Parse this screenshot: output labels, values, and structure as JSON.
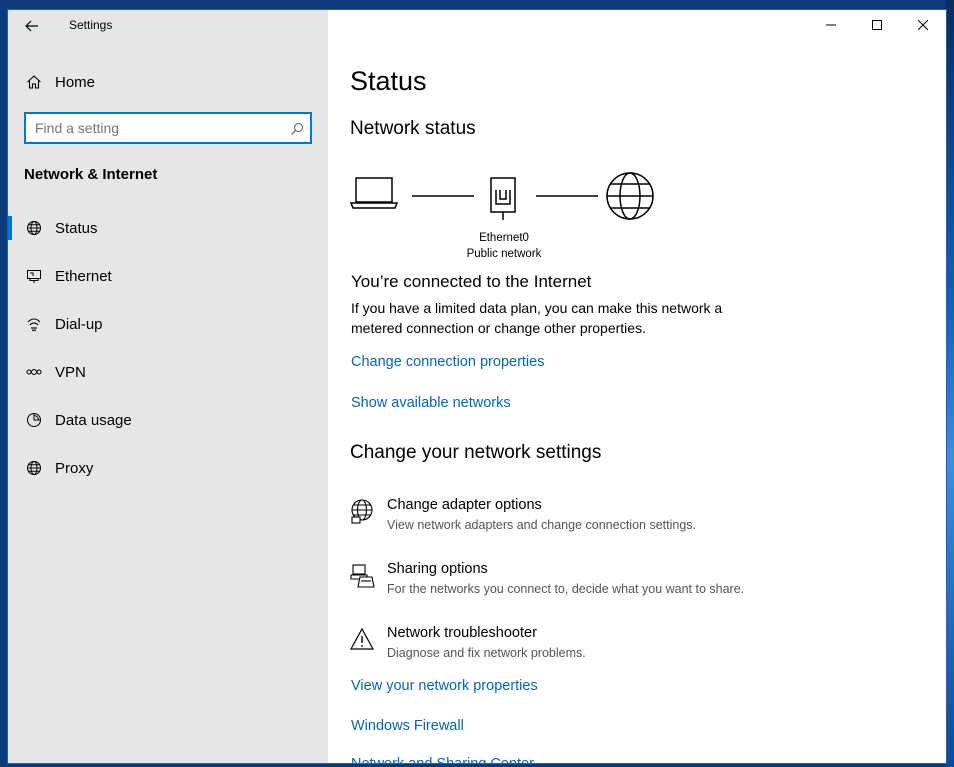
{
  "window": {
    "app_title": "Settings"
  },
  "sidebar": {
    "home_label": "Home",
    "search_placeholder": "Find a setting",
    "section_title": "Network & Internet",
    "items": [
      {
        "label": "Status",
        "icon": "globe-icon",
        "selected": true
      },
      {
        "label": "Ethernet",
        "icon": "ethernet-icon",
        "selected": false
      },
      {
        "label": "Dial-up",
        "icon": "dialup-icon",
        "selected": false
      },
      {
        "label": "VPN",
        "icon": "vpn-icon",
        "selected": false
      },
      {
        "label": "Data usage",
        "icon": "data-usage-icon",
        "selected": false
      },
      {
        "label": "Proxy",
        "icon": "globe-icon",
        "selected": false
      }
    ]
  },
  "main": {
    "page_title": "Status",
    "network_status_heading": "Network status",
    "diagram": {
      "adapter_name": "Ethernet0",
      "network_type": "Public network"
    },
    "connected_title": "You’re connected to the Internet",
    "connected_desc": "If you have a limited data plan, you can make this network a metered connection or change other properties.",
    "links": {
      "change_connection": "Change connection properties",
      "show_networks": "Show available networks"
    },
    "change_settings_heading": "Change your network settings",
    "options": [
      {
        "title": "Change adapter options",
        "desc": "View network adapters and change connection settings.",
        "icon": "adapter-globe-icon"
      },
      {
        "title": "Sharing options",
        "desc": "For the networks you connect to, decide what you want to share.",
        "icon": "sharing-icon"
      },
      {
        "title": "Network troubleshooter",
        "desc": "Diagnose and fix network problems.",
        "icon": "warning-icon"
      }
    ],
    "bottom_links": {
      "view_properties": "View your network properties",
      "firewall": "Windows Firewall",
      "sharing_center": "Network and Sharing Center"
    }
  },
  "colors": {
    "accent": "#0078d7",
    "link": "#0067b8",
    "sidebar_bg": "#e6e6e6"
  }
}
